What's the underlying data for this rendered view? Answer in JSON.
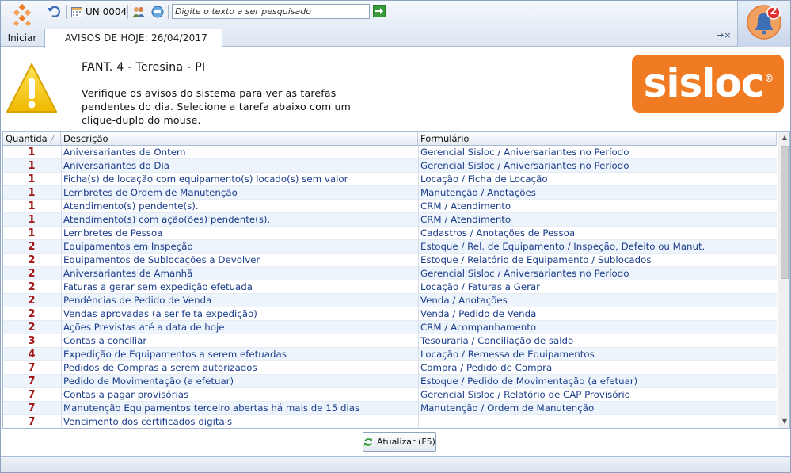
{
  "toolbar": {
    "start_label": "Iniciar",
    "unit_label": "UN 0004",
    "search_placeholder": "Digite o texto a ser pesquisado",
    "notification_count": "2"
  },
  "tab": {
    "label": "AVISOS DE HOJE: 26/04/2017",
    "close_label": "→×"
  },
  "header": {
    "title": "FANT. 4 - Teresina - PI",
    "message": "Verifique os avisos do sistema para ver as tarefas pendentes do dia. Selecione a tarefa abaixo com um clique-duplo do mouse.",
    "logo_text": "sisloc",
    "logo_mark": "®"
  },
  "colors": {
    "accent_orange": "#f07b22",
    "link_blue": "#1a3d8c",
    "quantity_red": "#a01818"
  },
  "grid": {
    "columns": [
      "Quantida",
      "Descrição",
      "Formulário"
    ],
    "sort_indicator": "/",
    "rows": [
      {
        "q": "1",
        "d": "Aniversariantes de Ontem",
        "f": "Gerencial Sisloc / Aniversariantes no Período"
      },
      {
        "q": "1",
        "d": "Aniversariantes do Dia",
        "f": "Gerencial Sisloc / Aniversariantes no Período"
      },
      {
        "q": "1",
        "d": "Ficha(s) de locação com equipamento(s) locado(s) sem valor",
        "f": "Locação / Ficha de Locação"
      },
      {
        "q": "1",
        "d": "Lembretes de Ordem de Manutenção",
        "f": "Manutenção / Anotações"
      },
      {
        "q": "1",
        "d": "Atendimento(s) pendente(s).",
        "f": "CRM / Atendimento"
      },
      {
        "q": "1",
        "d": "Atendimento(s) com ação(ões) pendente(s).",
        "f": "CRM / Atendimento"
      },
      {
        "q": "1",
        "d": "Lembretes de Pessoa",
        "f": "Cadastros / Anotações de Pessoa"
      },
      {
        "q": "2",
        "d": "Equipamentos em Inspeção",
        "f": "Estoque / Rel. de Equipamento / Inspeção, Defeito ou Manut."
      },
      {
        "q": "2",
        "d": "Equipamentos de Sublocações a Devolver",
        "f": "Estoque / Relatório de Equipamento / Sublocados"
      },
      {
        "q": "2",
        "d": "Aniversariantes de Amanhã",
        "f": "Gerencial Sisloc / Aniversariantes no Período"
      },
      {
        "q": "2",
        "d": "Faturas a gerar sem expedição efetuada",
        "f": "Locação / Faturas a Gerar"
      },
      {
        "q": "2",
        "d": "Pendências de Pedido de Venda",
        "f": "Venda / Anotações"
      },
      {
        "q": "2",
        "d": "Vendas aprovadas (a ser feita expedição)",
        "f": "Venda / Pedido de Venda"
      },
      {
        "q": "2",
        "d": "Ações Previstas até a data de hoje",
        "f": "CRM / Acompanhamento"
      },
      {
        "q": "3",
        "d": "Contas a conciliar",
        "f": "Tesouraria / Conciliação de saldo"
      },
      {
        "q": "4",
        "d": "Expedição de Equipamentos a serem efetuadas",
        "f": "Locação / Remessa de Equipamentos"
      },
      {
        "q": "7",
        "d": "Pedidos de Compras a serem autorizados",
        "f": "Compra / Pedido de Compra"
      },
      {
        "q": "7",
        "d": "Pedido de Movimentação (a efetuar)",
        "f": "Estoque / Pedido de Movimentação (a efetuar)"
      },
      {
        "q": "7",
        "d": "Contas a pagar provisórias",
        "f": "Gerencial Sisloc / Relatório de CAP Provisório"
      },
      {
        "q": "7",
        "d": "Manutenção Equipamentos terceiro abertas há mais de 15 dias",
        "f": "Manutenção / Ordem de Manutenção"
      },
      {
        "q": "7",
        "d": "Vencimento dos certificados digitais",
        "f": ""
      }
    ]
  },
  "footer": {
    "refresh_label": "Atualizar (F5)"
  },
  "icons": {
    "start": "start-logo-icon",
    "undo": "undo-icon",
    "calendar": "calendar-icon",
    "users": "users-icon",
    "chat": "chat-icon",
    "go": "arrow-right-icon",
    "bell": "bell-icon",
    "warning": "warning-icon",
    "refresh": "refresh-icon"
  }
}
